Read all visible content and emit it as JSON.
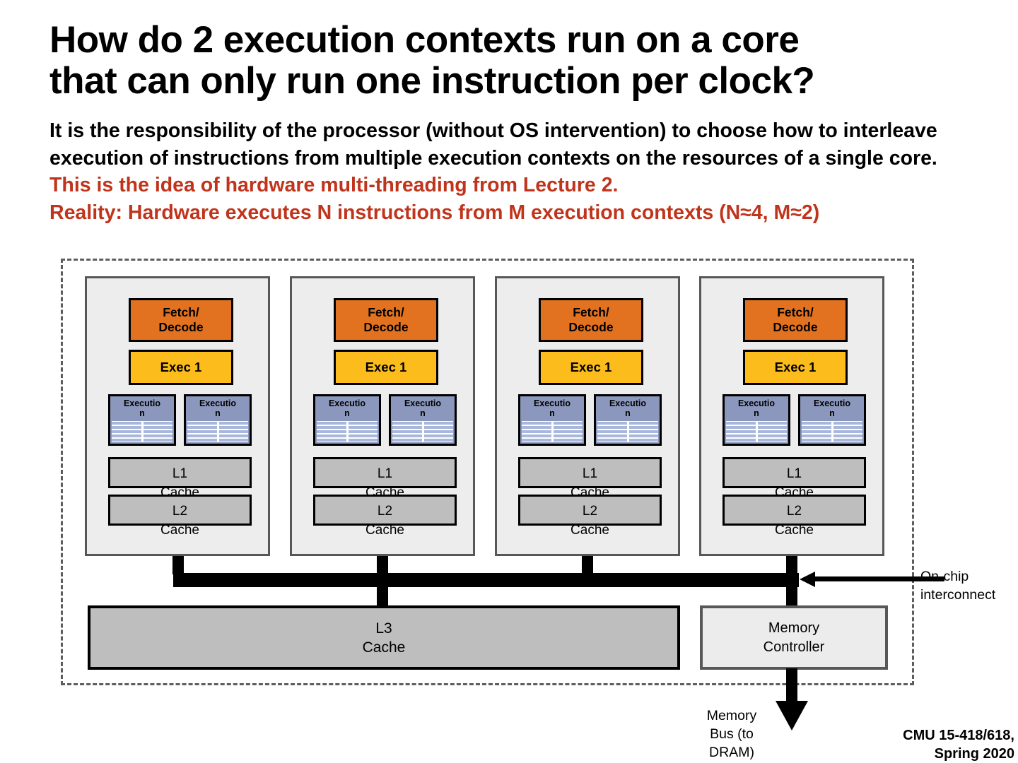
{
  "slide": {
    "title_line1": "How do 2 execution contexts run on a core",
    "title_line2": "that can only run one instruction per clock?",
    "body_black": "It is the responsibility of the processor (without OS intervention) to choose how to interleave execution of instructions from multiple execution contexts on the resources of a single core.",
    "body_red_line1": "This is the idea of hardware multi-threading from Lecture 2.",
    "body_red_line2": "Reality: Hardware executes N instructions from M execution contexts (N≈4, M≈2)",
    "footer": "CMU 15-418/618,\nSpring 2020"
  },
  "colors": {
    "fetch_decode": "#E2721F",
    "exec_unit": "#FCBD1C",
    "context": "#8B97BC",
    "context_grid": "#A9B7DC",
    "cache": "#BEBEBE",
    "core_fill": "#EDEDED",
    "memory_controller_fill": "#ECECEC",
    "chip_border": "#5D5D5D",
    "red_text": "#C0341B",
    "bus": "#000000"
  },
  "diagram": {
    "cores": [
      {
        "id": "core-0",
        "fetch_decode": "Fetch/\nDecode",
        "exec": "Exec 1",
        "contexts": [
          "Executio n",
          "Executio n"
        ],
        "l1": "L1\nCache",
        "l2": "L2\nCache"
      },
      {
        "id": "core-1",
        "fetch_decode": "Fetch/\nDecode",
        "exec": "Exec 1",
        "contexts": [
          "Executio n",
          "Executio n"
        ],
        "l1": "L1\nCache",
        "l2": "L2\nCache"
      },
      {
        "id": "core-2",
        "fetch_decode": "Fetch/\nDecode",
        "exec": "Exec 1",
        "contexts": [
          "Executio n",
          "Executio n"
        ],
        "l1": "L1\nCache",
        "l2": "L2\nCache"
      },
      {
        "id": "core-3",
        "fetch_decode": "Fetch/\nDecode",
        "exec": "Exec 1",
        "contexts": [
          "Executio n",
          "Executio n"
        ],
        "l1": "L1\nCache",
        "l2": "L2\nCache"
      }
    ],
    "l3_cache": "L3\nCache",
    "memory_controller": "Memory\nController",
    "interconnect_label": "On-chip\ninterconnect",
    "memory_bus_label": "Memory\nBus (to\nDRAM)"
  }
}
